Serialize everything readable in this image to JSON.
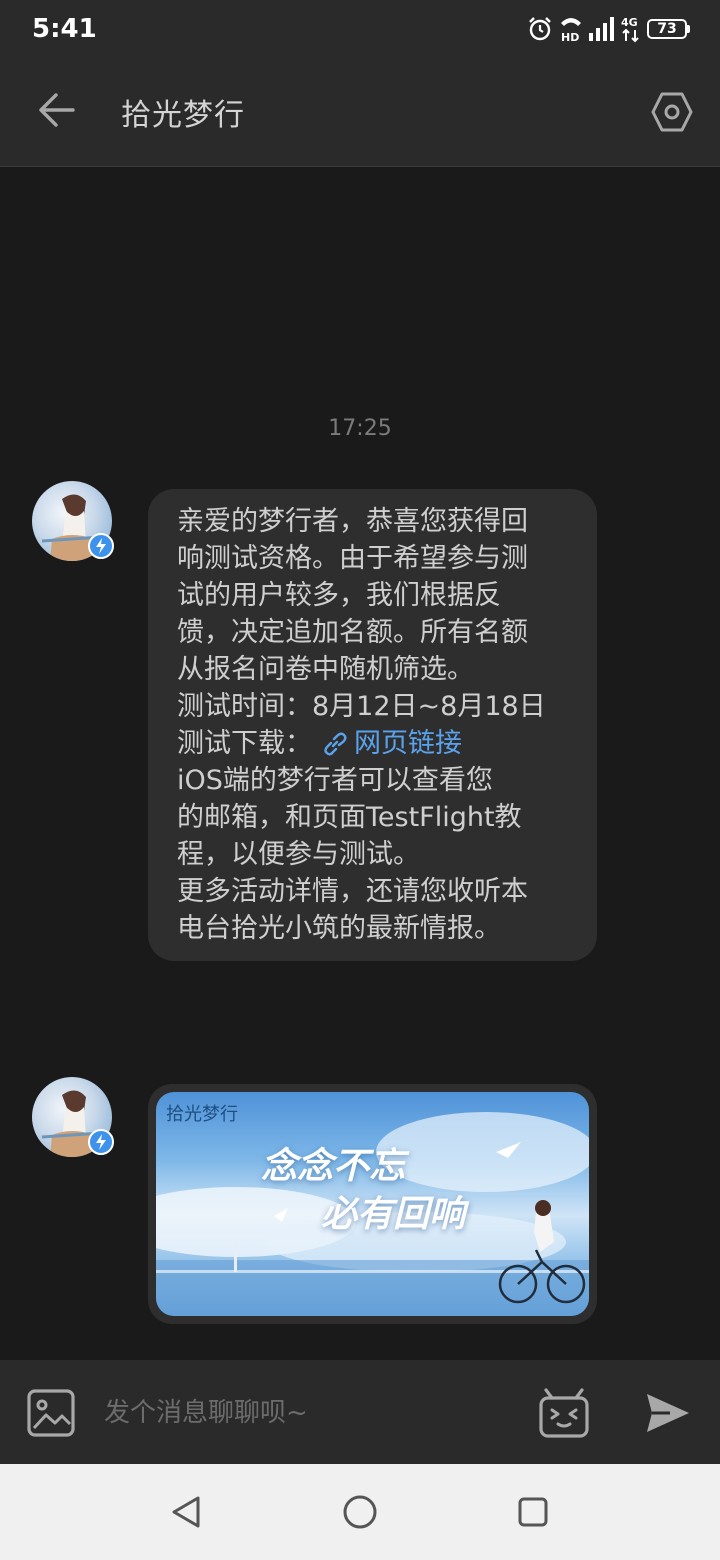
{
  "status_bar": {
    "time": "5:41",
    "network": "4G",
    "hd": "HD",
    "battery": "73"
  },
  "header": {
    "title": "拾光梦行"
  },
  "chat": {
    "timestamp": "17:25",
    "message": {
      "paragraph1": [
        "亲爱的梦行者，恭喜您获得回",
        "响测试资格。由于希望参与测",
        "试的用户较多，我们根据反",
        "馈，决定追加名额。所有名额",
        "从报名问卷中随机筛选。"
      ],
      "test_time": "测试时间：8月12日~8月18日",
      "download_label": "测试下载：",
      "download_link": "网页链接",
      "paragraph2": [
        "iOS端的梦行者可以查看您",
        "的邮箱，和页面TestFlight教",
        "程，以便参与测试。"
      ],
      "paragraph3": [
        "更多活动详情，还请您收听本",
        "电台拾光小筑的最新情报。"
      ]
    },
    "image_card": {
      "logo": "拾光梦行",
      "headline_line1": "念念不忘",
      "headline_line2": "必有回响"
    }
  },
  "input": {
    "placeholder": "发个消息聊聊呗~"
  },
  "colors": {
    "background": "#1a1a1b",
    "bar": "#2a2a2b",
    "bubble": "#2e2e2f",
    "link": "#5aa3ec",
    "badge": "#3d92ec"
  }
}
